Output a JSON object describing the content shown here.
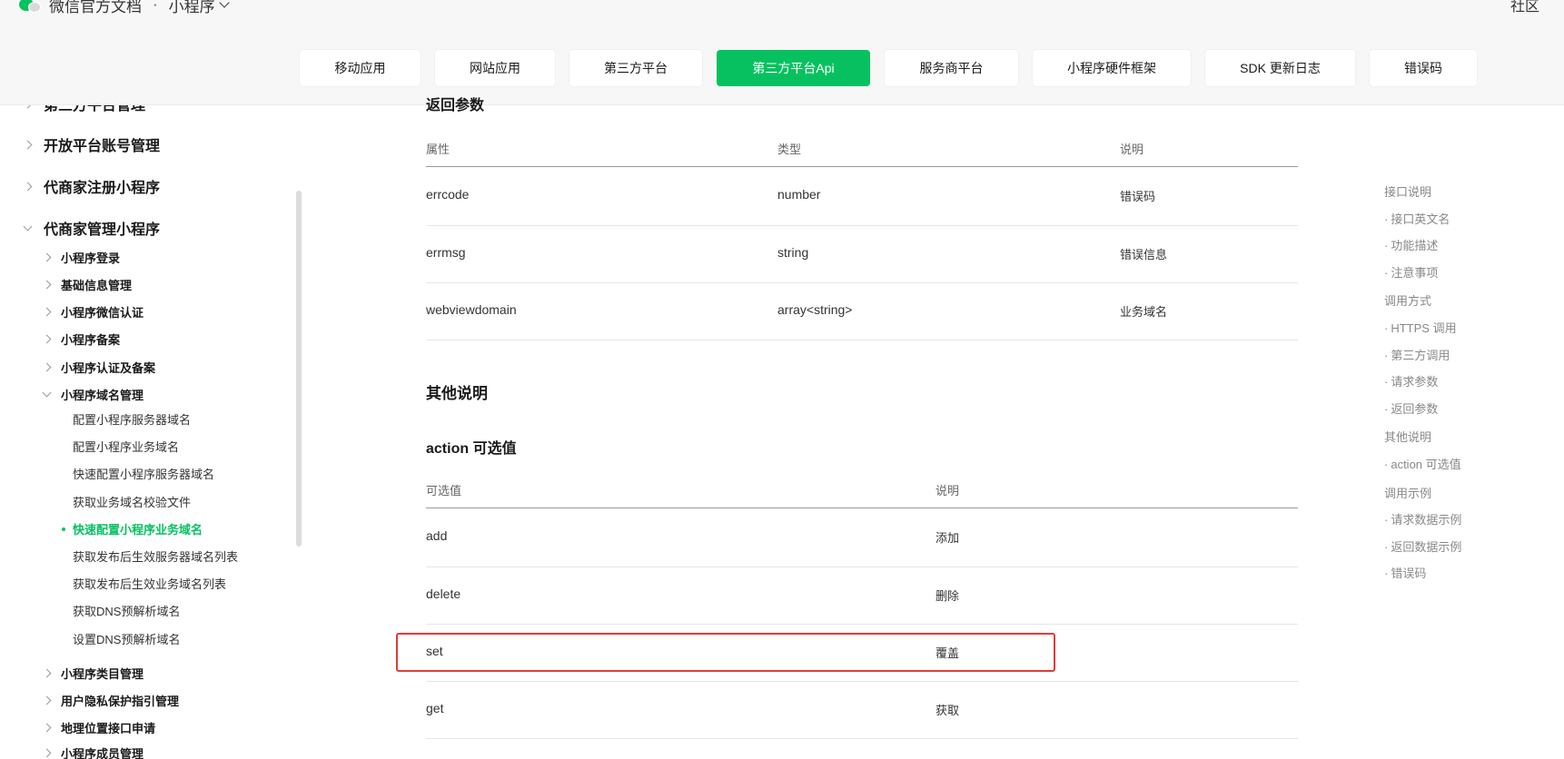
{
  "header": {
    "brand": "微信官方文档",
    "separator": "·",
    "section": "小程序",
    "community": "社区"
  },
  "tabs": [
    {
      "label": "移动应用",
      "active": false
    },
    {
      "label": "网站应用",
      "active": false
    },
    {
      "label": "第三方平台",
      "active": false
    },
    {
      "label": "第三方平台Api",
      "active": true
    },
    {
      "label": "服务商平台",
      "active": false
    },
    {
      "label": "小程序硬件框架",
      "active": false
    },
    {
      "label": "SDK 更新日志",
      "active": false
    },
    {
      "label": "错误码",
      "active": false
    }
  ],
  "sidebar": {
    "partial_top": "第三方平台管理",
    "level1": [
      {
        "label": "开放平台账号管理",
        "expanded": false
      },
      {
        "label": "代商家注册小程序",
        "expanded": false
      },
      {
        "label": "代商家管理小程序",
        "expanded": true
      }
    ],
    "level2": [
      {
        "label": "小程序登录",
        "expanded": false
      },
      {
        "label": "基础信息管理",
        "expanded": false
      },
      {
        "label": "小程序微信认证",
        "expanded": false
      },
      {
        "label": "小程序备案",
        "expanded": false
      },
      {
        "label": "小程序认证及备案",
        "expanded": false
      },
      {
        "label": "小程序域名管理",
        "expanded": true
      }
    ],
    "level3": [
      {
        "label": "配置小程序服务器域名",
        "active": false
      },
      {
        "label": "配置小程序业务域名",
        "active": false
      },
      {
        "label": "快速配置小程序服务器域名",
        "active": false
      },
      {
        "label": "获取业务域名校验文件",
        "active": false
      },
      {
        "label": "快速配置小程序业务域名",
        "active": true
      },
      {
        "label": "获取发布后生效服务器域名列表",
        "active": false
      },
      {
        "label": "获取发布后生效业务域名列表",
        "active": false
      },
      {
        "label": "获取DNS预解析域名",
        "active": false
      },
      {
        "label": "设置DNS预解析域名",
        "active": false
      }
    ],
    "level2_after": [
      {
        "label": "小程序类目管理"
      },
      {
        "label": "用户隐私保护指引管理"
      },
      {
        "label": "地理位置接口申请"
      },
      {
        "label": "小程序成员管理"
      }
    ]
  },
  "main": {
    "partial_heading": "返回参数",
    "return_table": {
      "headers": [
        "属性",
        "类型",
        "说明"
      ],
      "rows": [
        [
          "errcode",
          "number",
          "错误码"
        ],
        [
          "errmsg",
          "string",
          "错误信息"
        ],
        [
          "webviewdomain",
          "array<string>",
          "业务域名"
        ]
      ]
    },
    "other_title": "其他说明",
    "action_title": "action 可选值",
    "action_table": {
      "headers": [
        "可选值",
        "说明"
      ],
      "rows": [
        [
          "add",
          "添加"
        ],
        [
          "delete",
          "删除"
        ],
        [
          "set",
          "覆盖"
        ],
        [
          "get",
          "获取"
        ]
      ]
    }
  },
  "toc": [
    {
      "label": "接口说明",
      "sub": false
    },
    {
      "label": "接口英文名",
      "sub": true
    },
    {
      "label": "功能描述",
      "sub": true
    },
    {
      "label": "注意事项",
      "sub": true
    },
    {
      "label": "调用方式",
      "sub": false
    },
    {
      "label": "HTTPS 调用",
      "sub": true
    },
    {
      "label": "第三方调用",
      "sub": true
    },
    {
      "label": "请求参数",
      "sub": true
    },
    {
      "label": "返回参数",
      "sub": true
    },
    {
      "label": "其他说明",
      "sub": false
    },
    {
      "label": "action 可选值",
      "sub": true
    },
    {
      "label": "调用示例",
      "sub": false
    },
    {
      "label": "请求数据示例",
      "sub": true
    },
    {
      "label": "返回数据示例",
      "sub": true
    },
    {
      "label": "错误码",
      "sub": true
    }
  ],
  "colors": {
    "brand_green": "#07c160",
    "highlight_red": "#e53935"
  }
}
